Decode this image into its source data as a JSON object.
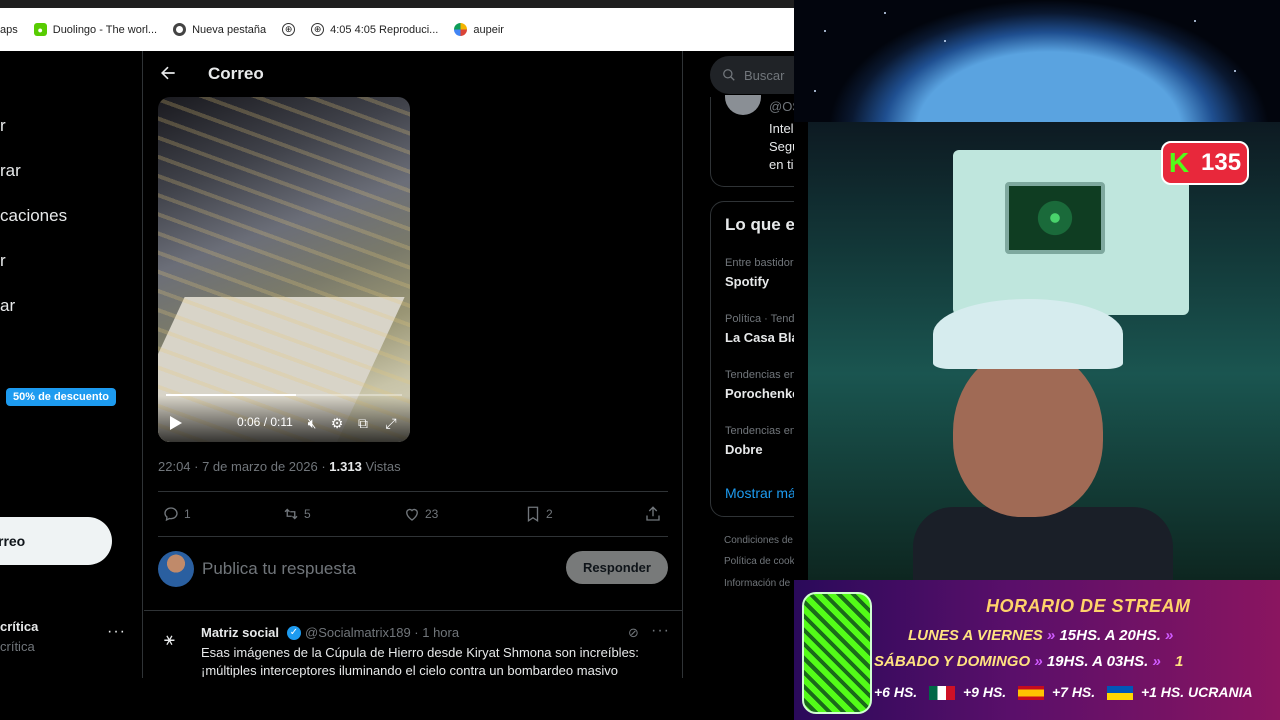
{
  "bookmarks": [
    {
      "label": "aps",
      "icon": "none"
    },
    {
      "label": "Duolingo - The worl...",
      "icon": "duolingo-icon"
    },
    {
      "label": "Nueva pestaña",
      "icon": "chrome-icon"
    },
    {
      "label": "",
      "icon": "globe-icon"
    },
    {
      "label": "4:05 4:05 Reproduci...",
      "icon": "globe-icon"
    },
    {
      "label": "aupeir",
      "icon": "pinwheel-icon"
    }
  ],
  "leftnav": {
    "items": [
      "r",
      "rar",
      "caciones",
      "r",
      "ar"
    ],
    "promo": "50% de descuento",
    "post_button": "rreo",
    "account_name": "crítica",
    "account_handle": "crítica",
    "more": "···"
  },
  "main": {
    "title": "Correo",
    "video": {
      "time": "0:06 / 0:11",
      "progress": 0.55
    },
    "meta": {
      "datetime": "22:04 · 7 de marzo de 2026 · ",
      "views_count": "1.313",
      "views_label": " Vistas"
    },
    "actions": {
      "replies": "1",
      "reposts": "5",
      "likes": "23",
      "bookmarks": "2"
    },
    "reply": {
      "placeholder": "Publica tu respuesta",
      "button": "Responder"
    },
    "next_tweet": {
      "name": "Matriz social",
      "handle": "@Socialmatrix189 · 1 hora",
      "text": "Esas imágenes de la Cúpula de Hierro desde Kiryat Shmona son increíbles: ¡múltiples interceptores iluminando el cielo contra un bombardeo masivo",
      "more": "···"
    }
  },
  "right": {
    "search_placeholder": "Buscar",
    "suggest": {
      "handle": "@OS",
      "bio": "Intelig\nSeguin\nen tien"
    },
    "trends_title": "Lo que est",
    "trends": [
      {
        "category": "Entre bastidores",
        "name": "Spotify"
      },
      {
        "category": "Política · Tender",
        "name": "La Casa Blanc"
      },
      {
        "category": "Tendencias en U",
        "name": "Porochenko"
      },
      {
        "category": "Tendencias en U",
        "name": "Dobre"
      }
    ],
    "show_more": "Mostrar más",
    "footer": [
      "Condiciones de se",
      "Política de cookies",
      "Información de"
    ]
  },
  "stream": {
    "viewers": "135",
    "kick_letter": "K",
    "schedule_title": "HORARIO DE STREAM",
    "rows": [
      {
        "days": "LUNES A VIERNES",
        "arrows": "»",
        "time": "15HS. A 20HS.",
        "tail": "»"
      },
      {
        "days": "SÁBADO Y DOMINGO",
        "arrows": "»",
        "time": "19HS. A 03HS.",
        "tail": "»"
      }
    ],
    "zones": [
      "+6 HS.",
      "+9 HS.",
      "+7 HS.",
      "+1 HS. UCRANIA"
    ],
    "extra_mark": "1"
  },
  "colors": {
    "accent": "#1d9bf0",
    "kick_green": "#53fc18",
    "kick_red": "#e8283b",
    "schedule_text": "#ffd36a"
  }
}
